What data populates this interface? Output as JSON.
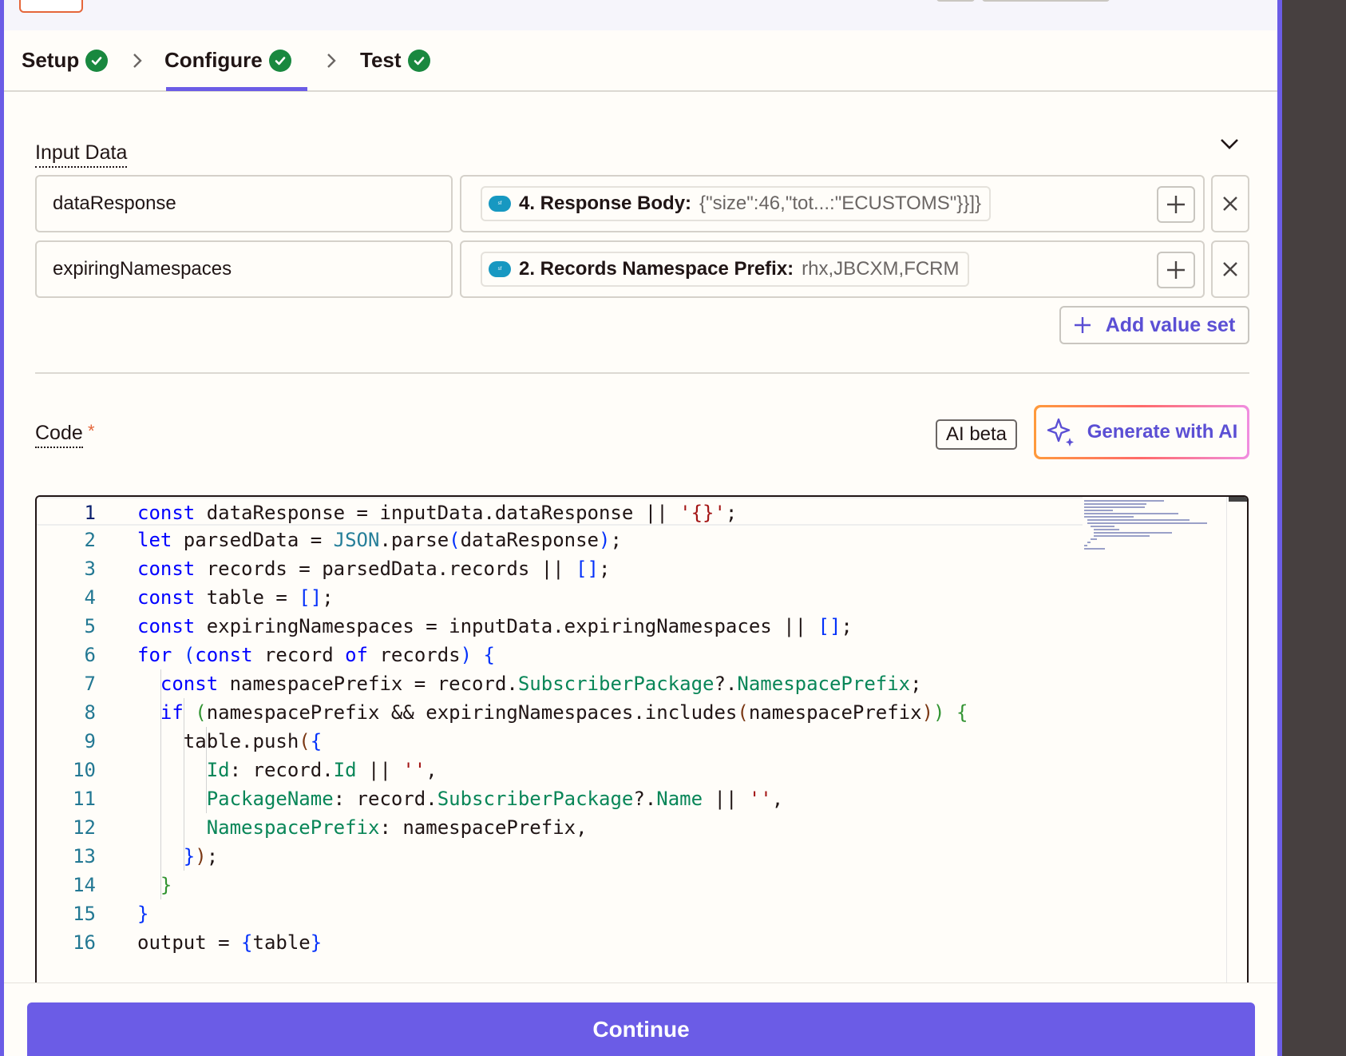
{
  "steps": [
    {
      "label": "Setup",
      "status": "complete"
    },
    {
      "label": "Configure",
      "status": "complete",
      "active": true
    },
    {
      "label": "Test",
      "status": "complete"
    }
  ],
  "input_data": {
    "label": "Input Data",
    "rows": [
      {
        "key": "dataResponse",
        "source_icon": "salesforce-icon",
        "value_title": "4. Response Body:",
        "value_preview": "{\"size\":46,\"tot...:\"ECUSTOMS\"}}]}"
      },
      {
        "key": "expiringNamespaces",
        "source_icon": "salesforce-icon",
        "value_title": "2. Records Namespace Prefix:",
        "value_preview": "rhx,JBCXM,FCRM"
      }
    ],
    "add_value_set_label": "Add value set"
  },
  "code_section": {
    "label": "Code",
    "required_mark": "*",
    "ai_badge": "AI beta",
    "generate_label": "Generate with AI",
    "line_numbers": [
      "1",
      "2",
      "3",
      "4",
      "5",
      "6",
      "7",
      "8",
      "9",
      "10",
      "11",
      "12",
      "13",
      "14",
      "15",
      "16"
    ]
  },
  "footer": {
    "continue_label": "Continue"
  },
  "colors": {
    "accent": "#6b5ce6",
    "success": "#19883f",
    "orange": "#e5663a"
  }
}
